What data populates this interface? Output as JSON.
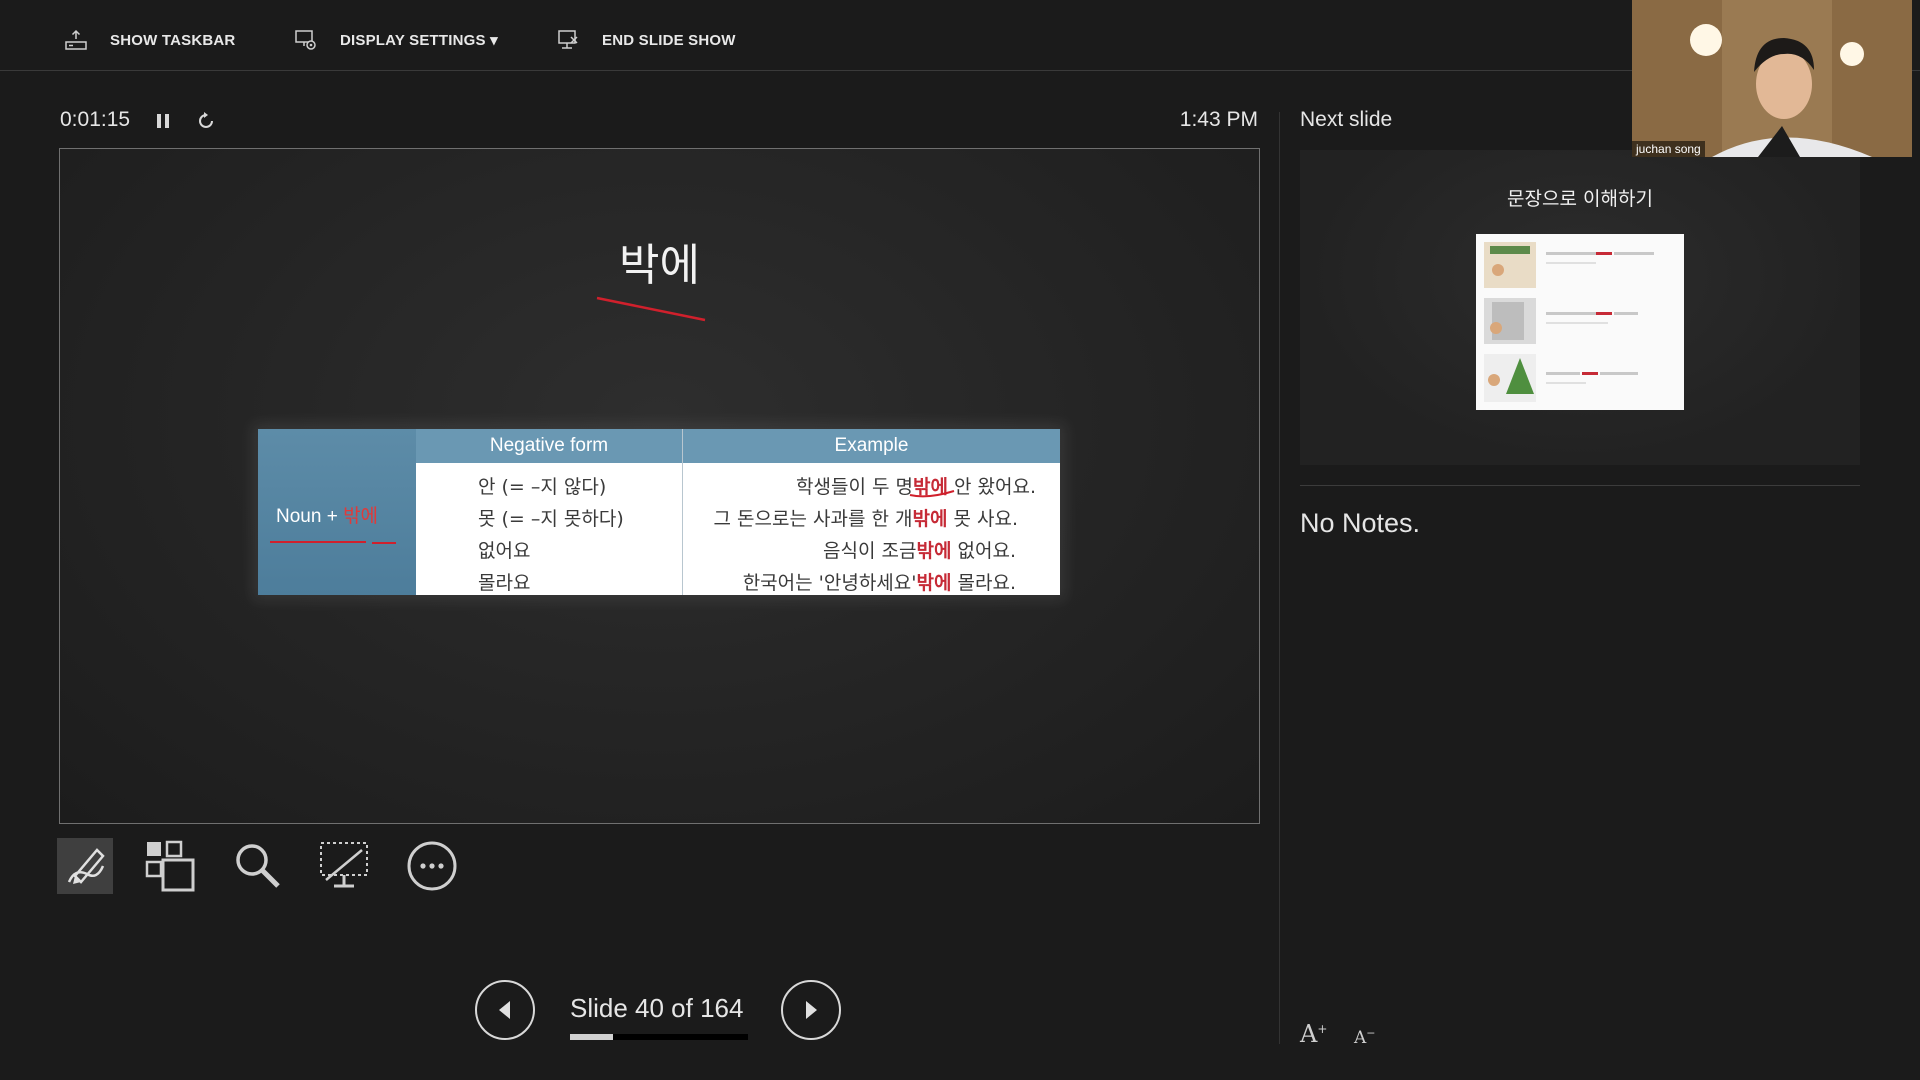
{
  "toolbar": {
    "show_taskbar": "SHOW TASKBAR",
    "display_settings": "DISPLAY SETTINGS ▾",
    "end_slide_show": "END SLIDE SHOW"
  },
  "presenter": {
    "timer": "0:01:15",
    "clock": "1:43 PM"
  },
  "slide": {
    "title": "박에",
    "table": {
      "headers": [
        "Negative form",
        "Example"
      ],
      "noun_label_prefix": "Noun + ",
      "noun_label_red": "밖에",
      "negative_forms": [
        "안 (= –지 않다)",
        "못 (= –지 못하다)",
        "없어요",
        "몰라요"
      ],
      "examples": [
        {
          "pre": "학생들이 두 명",
          "red": "밖에",
          "post": " 안 왔어요."
        },
        {
          "pre": "그 돈으로는 사과를 한 개",
          "red": "밖에",
          "post": " 못 사요."
        },
        {
          "pre": "음식이 조금",
          "red": "밖에",
          "post": " 없어요."
        },
        {
          "pre": "한국어는 '안녕하세요'",
          "red": "밖에",
          "post": " 몰라요."
        }
      ]
    }
  },
  "navigation": {
    "slide_count": "Slide 40 of 164",
    "progress_fraction": 0.24
  },
  "next_slide": {
    "label": "Next slide",
    "title": "문장으로 이해하기"
  },
  "notes": {
    "text": "No Notes."
  },
  "webcam": {
    "name": "juchan song"
  },
  "icons": {
    "pen": "pen-tool-icon",
    "grid": "see-all-slides-icon",
    "zoom": "zoom-icon",
    "screen": "black-screen-icon",
    "more": "more-options-icon"
  }
}
